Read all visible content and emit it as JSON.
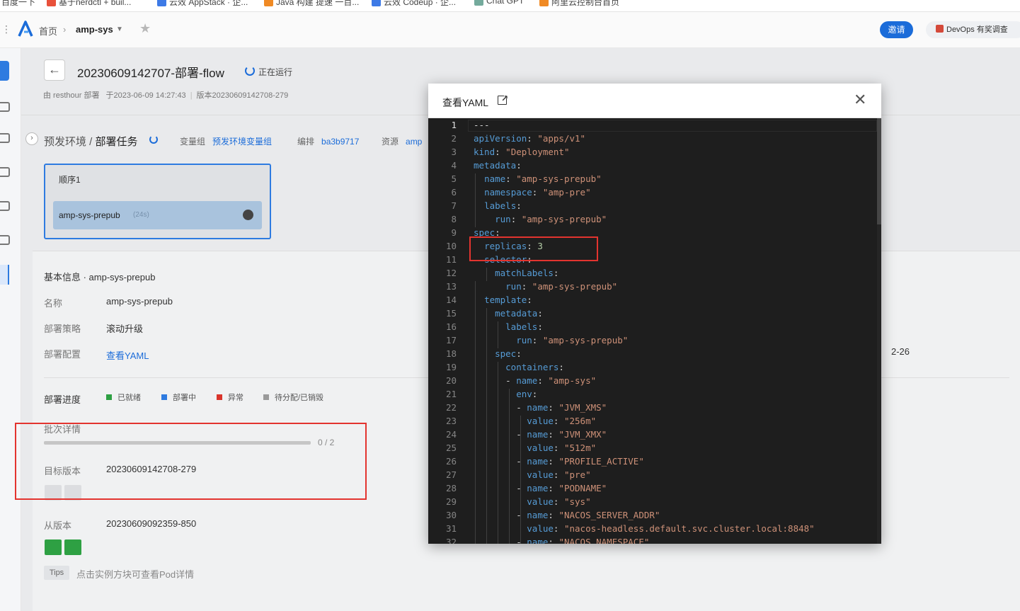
{
  "bookmarks": [
    {
      "label": "百度一下",
      "color": "#ffffff"
    },
    {
      "label": "基于nerdctl + buil...",
      "color": "#e8513b"
    },
    {
      "label": "云效 AppStack · 企...",
      "color": "#3d7ae6"
    },
    {
      "label": "Java 构建 提速 一百...",
      "color": "#f08a24"
    },
    {
      "label": "云效 Codeup · 企...",
      "color": "#3d7ae6"
    },
    {
      "label": "Chat GPT",
      "color": "#74aa9c"
    },
    {
      "label": "阿里云控制台首页",
      "color": "#f08a24"
    }
  ],
  "header": {
    "home": "首页",
    "app": "amp-sys",
    "invite": "邀请",
    "survey": "DevOps 有奖调查"
  },
  "page": {
    "title": "20230609142707-部署-flow",
    "status": "正在运行",
    "meta_by": "由 resthour 部署",
    "meta_time": "于2023-06-09 14:27:43",
    "meta_version": "版本20230609142708-279"
  },
  "stage": {
    "env": "预发环境",
    "task": "部署任务",
    "vargroup_label": "变量组",
    "vargroup_value": "预发环境变量组",
    "orch_label": "编排",
    "orch_value": "ba3b9717",
    "res_label": "资源",
    "res_value": "amp",
    "seq_title": "顺序1",
    "task_name": "amp-sys-prepub",
    "task_time": "(24s)"
  },
  "info": {
    "section": "基本信息 · amp-sys-prepub",
    "name_label": "名称",
    "name_value": "amp-sys-prepub",
    "strategy_label": "部署策略",
    "strategy_value": "滚动升级",
    "config_label": "部署配置",
    "config_link": "查看YAML",
    "date_partial": "2-26"
  },
  "progress": {
    "label": "部署进度",
    "legend": [
      {
        "label": "已就绪",
        "color": "#2ea043"
      },
      {
        "label": "部署中",
        "color": "#2e7be0"
      },
      {
        "label": "异常",
        "color": "#d9342b"
      },
      {
        "label": "待分配/已销毁",
        "color": "#9a9a9a"
      }
    ],
    "batch_label": "批次详情",
    "done": 0,
    "total": 2,
    "count_text": "0 / 2",
    "target_label": "目标版本",
    "target_value": "20230609142708-279",
    "from_label": "从版本",
    "from_value": "20230609092359-850",
    "tips_badge": "Tips",
    "tips_text": "点击实例方块可查看Pod详情"
  },
  "modal": {
    "title": "查看YAML",
    "lines": [
      [
        [
          "t",
          "---"
        ]
      ],
      [
        [
          "k",
          "apiVersion"
        ],
        [
          "t",
          ": "
        ],
        [
          "s",
          "\"apps/v1\""
        ]
      ],
      [
        [
          "k",
          "kind"
        ],
        [
          "t",
          ": "
        ],
        [
          "s",
          "\"Deployment\""
        ]
      ],
      [
        [
          "k",
          "metadata"
        ],
        [
          "t",
          ":"
        ]
      ],
      [
        [
          "t",
          "  "
        ],
        [
          "k",
          "name"
        ],
        [
          "t",
          ": "
        ],
        [
          "s",
          "\"amp-sys-prepub\""
        ]
      ],
      [
        [
          "t",
          "  "
        ],
        [
          "k",
          "namespace"
        ],
        [
          "t",
          ": "
        ],
        [
          "s",
          "\"amp-pre\""
        ]
      ],
      [
        [
          "t",
          "  "
        ],
        [
          "k",
          "labels"
        ],
        [
          "t",
          ":"
        ]
      ],
      [
        [
          "t",
          "    "
        ],
        [
          "k",
          "run"
        ],
        [
          "t",
          ": "
        ],
        [
          "s",
          "\"amp-sys-prepub\""
        ]
      ],
      [
        [
          "k",
          "spec"
        ],
        [
          "t",
          ":"
        ]
      ],
      [
        [
          "t",
          "  "
        ],
        [
          "k",
          "replicas"
        ],
        [
          "t",
          ": "
        ],
        [
          "n",
          "3"
        ]
      ],
      [
        [
          "t",
          "  "
        ],
        [
          "k",
          "selector"
        ],
        [
          "t",
          ":"
        ]
      ],
      [
        [
          "t",
          "    "
        ],
        [
          "k",
          "matchLabels"
        ],
        [
          "t",
          ":"
        ]
      ],
      [
        [
          "t",
          "      "
        ],
        [
          "k",
          "run"
        ],
        [
          "t",
          ": "
        ],
        [
          "s",
          "\"amp-sys-prepub\""
        ]
      ],
      [
        [
          "t",
          "  "
        ],
        [
          "k",
          "template"
        ],
        [
          "t",
          ":"
        ]
      ],
      [
        [
          "t",
          "    "
        ],
        [
          "k",
          "metadata"
        ],
        [
          "t",
          ":"
        ]
      ],
      [
        [
          "t",
          "      "
        ],
        [
          "k",
          "labels"
        ],
        [
          "t",
          ":"
        ]
      ],
      [
        [
          "t",
          "        "
        ],
        [
          "k",
          "run"
        ],
        [
          "t",
          ": "
        ],
        [
          "s",
          "\"amp-sys-prepub\""
        ]
      ],
      [
        [
          "t",
          "    "
        ],
        [
          "k",
          "spec"
        ],
        [
          "t",
          ":"
        ]
      ],
      [
        [
          "t",
          "      "
        ],
        [
          "k",
          "containers"
        ],
        [
          "t",
          ":"
        ]
      ],
      [
        [
          "t",
          "      - "
        ],
        [
          "k",
          "name"
        ],
        [
          "t",
          ": "
        ],
        [
          "s",
          "\"amp-sys\""
        ]
      ],
      [
        [
          "t",
          "        "
        ],
        [
          "k",
          "env"
        ],
        [
          "t",
          ":"
        ]
      ],
      [
        [
          "t",
          "        - "
        ],
        [
          "k",
          "name"
        ],
        [
          "t",
          ": "
        ],
        [
          "s",
          "\"JVM_XMS\""
        ]
      ],
      [
        [
          "t",
          "          "
        ],
        [
          "k",
          "value"
        ],
        [
          "t",
          ": "
        ],
        [
          "s",
          "\"256m\""
        ]
      ],
      [
        [
          "t",
          "        - "
        ],
        [
          "k",
          "name"
        ],
        [
          "t",
          ": "
        ],
        [
          "s",
          "\"JVM_XMX\""
        ]
      ],
      [
        [
          "t",
          "          "
        ],
        [
          "k",
          "value"
        ],
        [
          "t",
          ": "
        ],
        [
          "s",
          "\"512m\""
        ]
      ],
      [
        [
          "t",
          "        - "
        ],
        [
          "k",
          "name"
        ],
        [
          "t",
          ": "
        ],
        [
          "s",
          "\"PROFILE_ACTIVE\""
        ]
      ],
      [
        [
          "t",
          "          "
        ],
        [
          "k",
          "value"
        ],
        [
          "t",
          ": "
        ],
        [
          "s",
          "\"pre\""
        ]
      ],
      [
        [
          "t",
          "        - "
        ],
        [
          "k",
          "name"
        ],
        [
          "t",
          ": "
        ],
        [
          "s",
          "\"PODNAME\""
        ]
      ],
      [
        [
          "t",
          "          "
        ],
        [
          "k",
          "value"
        ],
        [
          "t",
          ": "
        ],
        [
          "s",
          "\"sys\""
        ]
      ],
      [
        [
          "t",
          "        - "
        ],
        [
          "k",
          "name"
        ],
        [
          "t",
          ": "
        ],
        [
          "s",
          "\"NACOS_SERVER_ADDR\""
        ]
      ],
      [
        [
          "t",
          "          "
        ],
        [
          "k",
          "value"
        ],
        [
          "t",
          ": "
        ],
        [
          "s",
          "\"nacos-headless.default.svc.cluster.local:8848\""
        ]
      ],
      [
        [
          "t",
          "        - "
        ],
        [
          "k",
          "name"
        ],
        [
          "t",
          ": "
        ],
        [
          "s",
          "\"NACOS_NAMESPACE\""
        ]
      ]
    ]
  }
}
